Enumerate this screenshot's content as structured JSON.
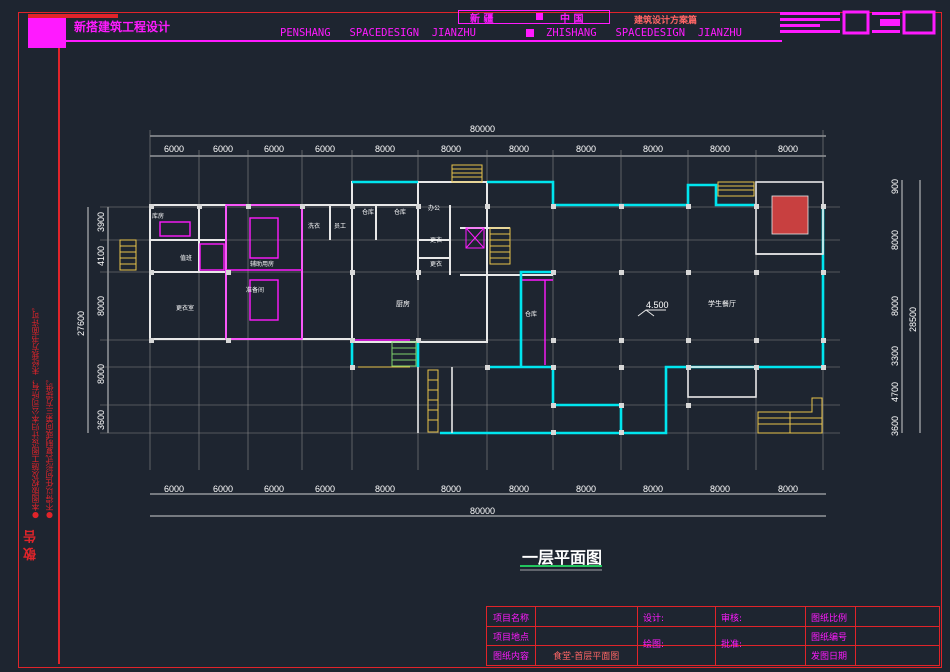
{
  "header": {
    "company": "新搭建筑工程设计",
    "center_title_left": "新 疆",
    "center_title_right": "中 国",
    "scheme": "建筑设计方案篇",
    "slogan_left": "PENSHANG   SPACEDESIGN  JIANZHU",
    "slogan_right": "ZHISHANG   SPACEDESIGN  JIANZHU"
  },
  "notice": {
    "title": "敬 告",
    "line1": "●本图版权及施工图设计归本公司所有，未经我方书面许可。",
    "line2": "●不得以任何形式复制或向第三方提供。"
  },
  "plan": {
    "title": "一层平面图",
    "overall_width": "80000",
    "bays": [
      "6000",
      "6000",
      "6000",
      "6000",
      "8000",
      "8000",
      "8000",
      "8000",
      "8000",
      "8000"
    ],
    "left_rows": [
      "3900",
      "4100",
      "8000",
      "8000",
      "3600"
    ],
    "left_total": "27600",
    "right_rows": [
      "900",
      "8000",
      "8000",
      "3300",
      "4700",
      "3600"
    ],
    "right_total": "28500",
    "elevation": "4.500",
    "rooms": {
      "kitchen": "厨房",
      "dining": "学生餐厅",
      "storage": "仓库",
      "changing": "更衣室",
      "office": "办公",
      "restroom1": "更衣",
      "restroom2": "更衣",
      "laundry": "洗衣",
      "guard": "值班",
      "warehouse1": "仓库",
      "warehouse2": "仓库",
      "staff": "员工",
      "auxiliary": "辅助用房",
      "prep": "准备间",
      "pantry": "库房"
    }
  },
  "title_block": {
    "project_name_label": "项目名称",
    "project_site_label": "项目地点",
    "drawing_content_label": "图纸内容",
    "drawing_content_value": "食堂-首层平面图",
    "design_label": "设计:",
    "drawn_label": "绘图:",
    "review_label": "审核:",
    "approve_label": "批准:",
    "scale_label": "图纸比例",
    "number_label": "图纸编号",
    "date_label": "发图日期"
  },
  "colors": {
    "background": "#1e2530",
    "frame": "#e0242a",
    "magenta": "#ff1aff",
    "wall": "#00e5ee",
    "grid": "#b8b8b8",
    "stair": "#e8c34a"
  }
}
